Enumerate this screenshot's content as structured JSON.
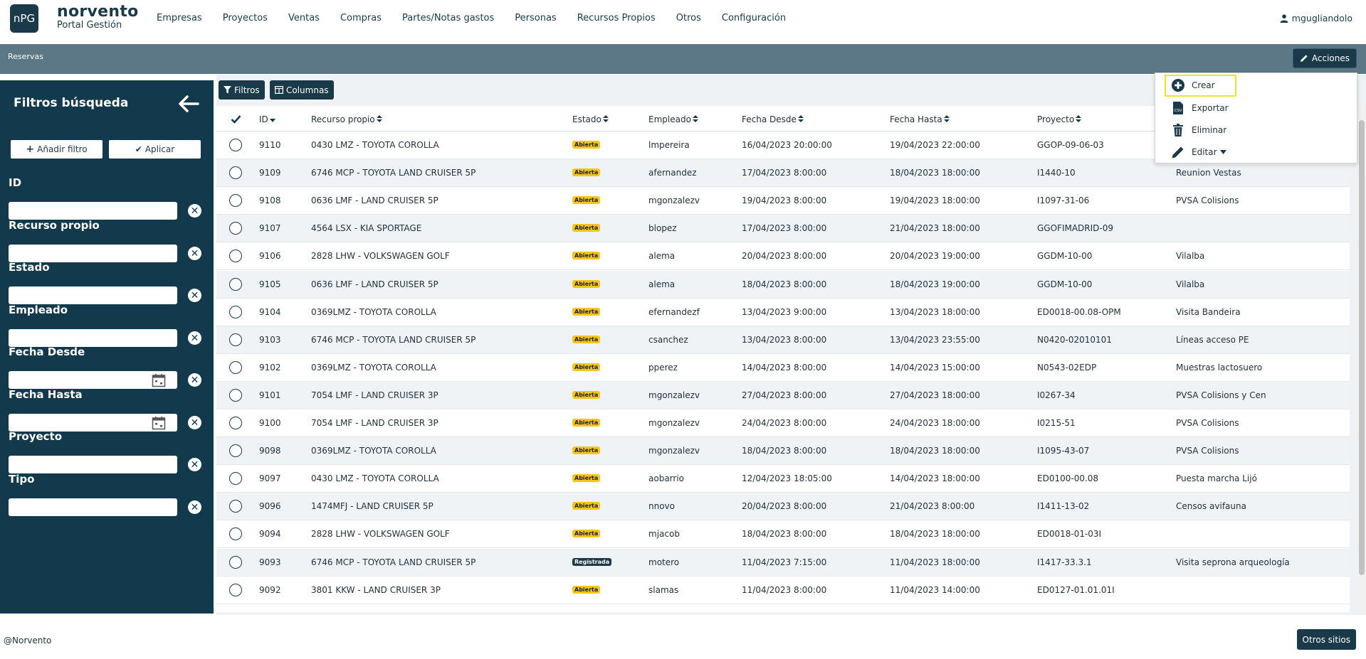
{
  "logo": {
    "short": "nPG",
    "name": "norvento",
    "subtitle": "Portal Gestión"
  },
  "nav": [
    "Empresas",
    "Proyectos",
    "Ventas",
    "Compras",
    "Partes/Notas gastos",
    "Personas",
    "Recursos Propios",
    "Otros",
    "Configuración"
  ],
  "user": {
    "name": "mgugliandolo",
    "icon": "user-icon"
  },
  "breadcrumb": "Reservas",
  "acciones_label": "Acciones",
  "actions_menu": [
    {
      "label": "Crear",
      "icon": "plus-circle-icon"
    },
    {
      "label": "Exportar",
      "icon": "csv-file-icon"
    },
    {
      "label": "Eliminar",
      "icon": "trash-icon"
    },
    {
      "label": "Editar",
      "icon": "pencil-icon"
    }
  ],
  "sidebar": {
    "title": "Filtros búsqueda",
    "add_filter": "Añadir filtro",
    "apply": "Aplicar",
    "filters": [
      "ID",
      "Recurso propio",
      "Estado",
      "Empleado",
      "Fecha Desde",
      "Fecha Hasta",
      "Proyecto",
      "Tipo"
    ]
  },
  "toolbar": {
    "filters": "Filtros",
    "columns": "Columnas"
  },
  "table": {
    "headers": [
      "ID",
      "Recurso propio",
      "Estado",
      "Empleado",
      "Fecha Desde",
      "Fecha Hasta",
      "Proyecto"
    ],
    "rows": [
      {
        "id": "9110",
        "recurso": "0430 LMZ - TOYOTA COROLLA",
        "estado": "Abierta",
        "empleado": "lmpereira",
        "desde": "16/04/2023 20:00:00",
        "hasta": "19/04/2023 22:00:00",
        "proyecto": "GGOP-09-06-03",
        "desc": ""
      },
      {
        "id": "9109",
        "recurso": "6746 MCP - TOYOTA LAND CRUISER 5P",
        "estado": "Abierta",
        "empleado": "afernandez",
        "desde": "17/04/2023 8:00:00",
        "hasta": "18/04/2023 18:00:00",
        "proyecto": "I1440-10",
        "desc": "Reunion Vestas"
      },
      {
        "id": "9108",
        "recurso": "0636 LMF - LAND CRUISER 5P",
        "estado": "Abierta",
        "empleado": "mgonzalezv",
        "desde": "19/04/2023 8:00:00",
        "hasta": "19/04/2023 18:00:00",
        "proyecto": "I1097-31-06",
        "desc": "PVSA Colisions"
      },
      {
        "id": "9107",
        "recurso": "4564 LSX - KIA SPORTAGE",
        "estado": "Abierta",
        "empleado": "blopez",
        "desde": "17/04/2023 8:00:00",
        "hasta": "21/04/2023 18:00:00",
        "proyecto": "GGOFIMADRID-09",
        "desc": ""
      },
      {
        "id": "9106",
        "recurso": "2828 LHW - VOLKSWAGEN GOLF",
        "estado": "Abierta",
        "empleado": "alema",
        "desde": "20/04/2023 8:00:00",
        "hasta": "20/04/2023 19:00:00",
        "proyecto": "GGDM-10-00",
        "desc": "Vilalba"
      },
      {
        "id": "9105",
        "recurso": "0636 LMF - LAND CRUISER 5P",
        "estado": "Abierta",
        "empleado": "alema",
        "desde": "18/04/2023 8:00:00",
        "hasta": "18/04/2023 19:00:00",
        "proyecto": "GGDM-10-00",
        "desc": "Vilalba"
      },
      {
        "id": "9104",
        "recurso": "0369LMZ - TOYOTA COROLLA",
        "estado": "Abierta",
        "empleado": "efernandezf",
        "desde": "13/04/2023 9:00:00",
        "hasta": "13/04/2023 18:00:00",
        "proyecto": "ED0018-00.08-OPM",
        "desc": "Visita Bandeira"
      },
      {
        "id": "9103",
        "recurso": "6746 MCP - TOYOTA LAND CRUISER 5P",
        "estado": "Abierta",
        "empleado": "csanchez",
        "desde": "13/04/2023 8:00:00",
        "hasta": "13/04/2023 23:55:00",
        "proyecto": "N0420-02010101",
        "desc": "Líneas acceso PE"
      },
      {
        "id": "9102",
        "recurso": "0369LMZ - TOYOTA COROLLA",
        "estado": "Abierta",
        "empleado": "pperez",
        "desde": "14/04/2023 8:00:00",
        "hasta": "14/04/2023 15:00:00",
        "proyecto": "N0543-02EDP",
        "desc": "Muestras lactosuero"
      },
      {
        "id": "9101",
        "recurso": "7054 LMF - LAND CRUISER 3P",
        "estado": "Abierta",
        "empleado": "mgonzalezv",
        "desde": "27/04/2023 8:00:00",
        "hasta": "27/04/2023 18:00:00",
        "proyecto": "I0267-34",
        "desc": "PVSA Colisions y Cen"
      },
      {
        "id": "9100",
        "recurso": "7054 LMF - LAND CRUISER 3P",
        "estado": "Abierta",
        "empleado": "mgonzalezv",
        "desde": "24/04/2023 8:00:00",
        "hasta": "24/04/2023 18:00:00",
        "proyecto": "I0215-51",
        "desc": "PVSA Colisions"
      },
      {
        "id": "9098",
        "recurso": "0369LMZ - TOYOTA COROLLA",
        "estado": "Abierta",
        "empleado": "mgonzalezv",
        "desde": "18/04/2023 8:00:00",
        "hasta": "18/04/2023 18:00:00",
        "proyecto": "I1095-43-07",
        "desc": "PVSA Colisions"
      },
      {
        "id": "9097",
        "recurso": "0430 LMZ - TOYOTA COROLLA",
        "estado": "Abierta",
        "empleado": "aobarrio",
        "desde": "12/04/2023 18:05:00",
        "hasta": "14/04/2023 18:00:00",
        "proyecto": "ED0100-00.08",
        "desc": "Puesta marcha Lijó"
      },
      {
        "id": "9096",
        "recurso": "1474MFJ - LAND CRUISER 5P",
        "estado": "Abierta",
        "empleado": "nnovo",
        "desde": "20/04/2023 8:00:00",
        "hasta": "21/04/2023 8:00:00",
        "proyecto": "I1411-13-02",
        "desc": "Censos avifauna"
      },
      {
        "id": "9094",
        "recurso": "2828 LHW - VOLKSWAGEN GOLF",
        "estado": "Abierta",
        "empleado": "mjacob",
        "desde": "18/04/2023 8:00:00",
        "hasta": "18/04/2023 18:00:00",
        "proyecto": "ED0018-01-03I",
        "desc": ""
      },
      {
        "id": "9093",
        "recurso": "6746 MCP - TOYOTA LAND CRUISER 5P",
        "estado": "Registrada",
        "empleado": "motero",
        "desde": "11/04/2023 7:15:00",
        "hasta": "11/04/2023 18:00:00",
        "proyecto": "I1417-33.3.1",
        "desc": "Visita seprona arqueología"
      },
      {
        "id": "9092",
        "recurso": "3801 KKW - LAND CRUISER 3P",
        "estado": "Abierta",
        "empleado": "slamas",
        "desde": "11/04/2023 8:00:00",
        "hasta": "11/04/2023 14:00:00",
        "proyecto": "ED0127-01.01.01I",
        "desc": ""
      }
    ]
  },
  "footer": {
    "copyright": "@Norvento",
    "otros_sitios": "Otros sitios"
  },
  "colors": {
    "primary": "#1a3a4a",
    "sidebar": "#123a4c",
    "crumbbar": "#5c7886",
    "badge_open": "#f5c518",
    "highlight": "#f0e52a"
  }
}
